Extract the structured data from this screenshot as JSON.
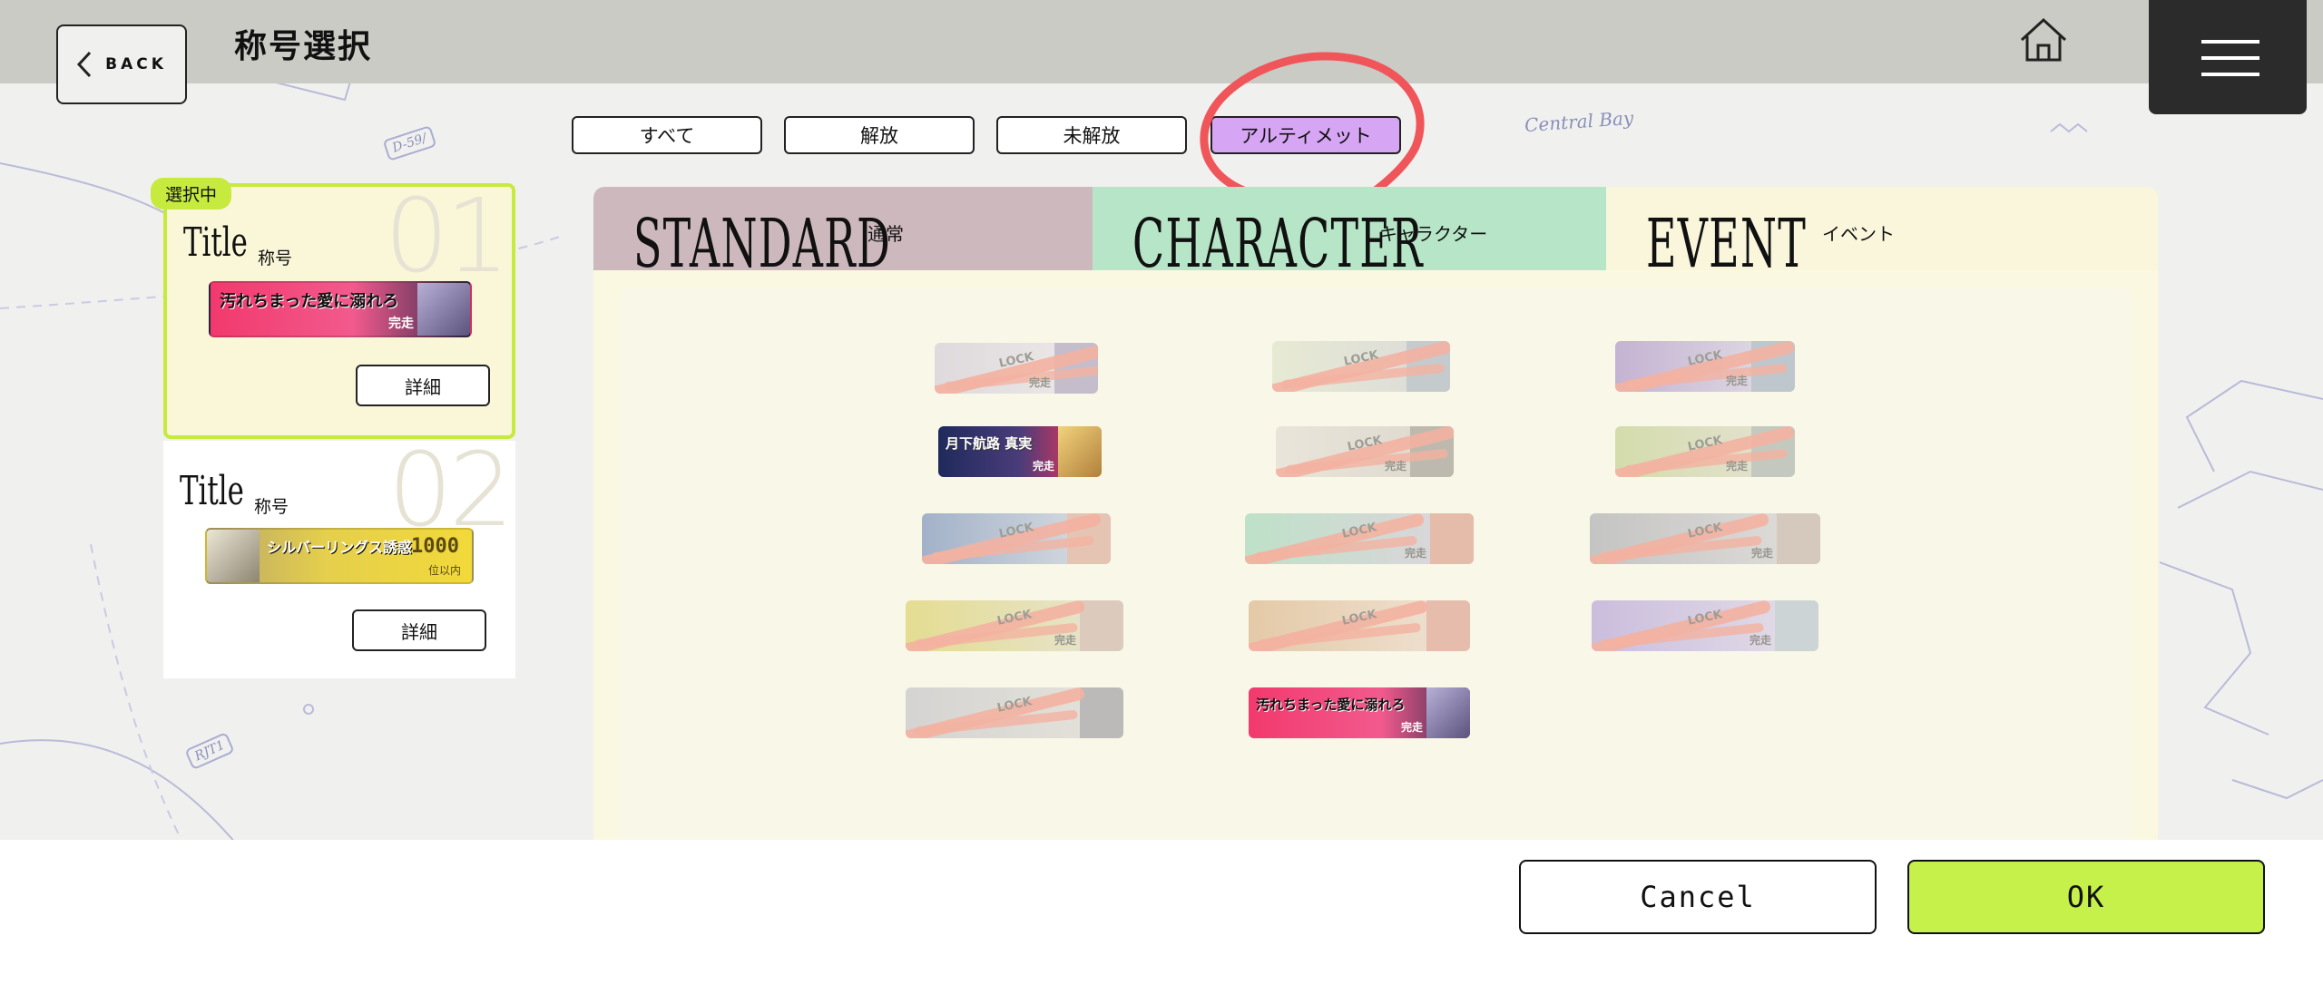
{
  "header": {
    "back_label": "BACK",
    "title": "称号選択"
  },
  "map_labels": {
    "bay": "Central Bay",
    "tag1": "D-59/",
    "tag2": "RJT1"
  },
  "filters": [
    {
      "label": "すべて",
      "active": false
    },
    {
      "label": "解放",
      "active": false
    },
    {
      "label": "未解放",
      "active": false
    },
    {
      "label": "アルティメット",
      "active": true
    }
  ],
  "slots": [
    {
      "selected_badge": "選択中",
      "number": "01",
      "title": "Title",
      "subtitle": "称号",
      "badge_text": "汚れちまった愛に溺れろ",
      "badge_tag": "完走",
      "detail_label": "詳細",
      "selected": true
    },
    {
      "number": "02",
      "title": "Title",
      "subtitle": "称号",
      "badge_text": "シルバーリングス誘惑",
      "badge_score": "1000",
      "badge_rank": "位以内",
      "detail_label": "詳細",
      "selected": false
    }
  ],
  "categories": [
    {
      "name": "STANDARD",
      "jp": "通常",
      "color": "#cdb9bd"
    },
    {
      "name": "CHARACTER",
      "jp": "キャラクター",
      "color": "#b6e6c7"
    },
    {
      "name": "EVENT",
      "jp": "イベント",
      "color": "#faf6dc"
    }
  ],
  "grid": {
    "lock_label": "LOCK",
    "done_label": "完走",
    "unlocked_texts": [
      "月下航路 真実",
      "汚れちまった愛に溺れろ"
    ]
  },
  "footer": {
    "cancel_label": "Cancel",
    "ok_label": "OK"
  },
  "colors": {
    "accent_green": "#c6f04a",
    "ultimate_purple": "#d6a6f4",
    "header_gray": "#cacbc4",
    "menu_dark": "#2b2b2b",
    "annotation_red": "#f0555a"
  }
}
